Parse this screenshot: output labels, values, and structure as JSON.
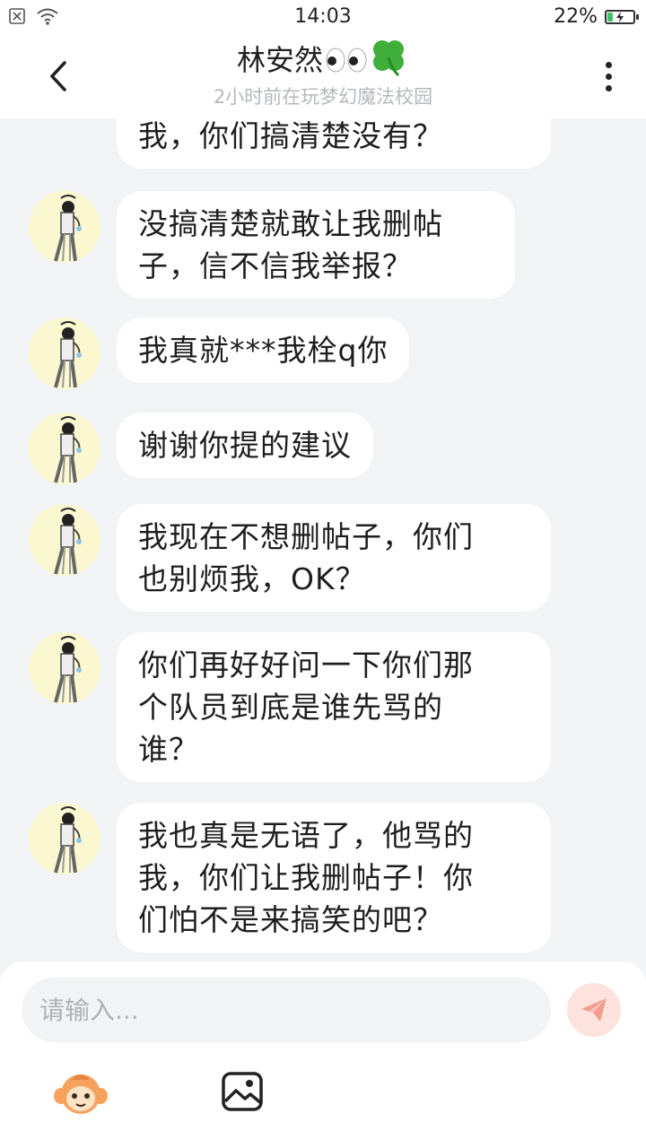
{
  "status_bar": {
    "time": "14:03",
    "battery": "22%",
    "battery_level": 0.22,
    "battery_color": "#3cc46b"
  },
  "header": {
    "title": "林安然",
    "subtitle": "2小时前在玩梦幻魔法校园"
  },
  "messages": [
    {
      "text": "我，你们搞清楚没有？"
    },
    {
      "text": "没搞清楚就敢让我删帖\n子，信不信我举报？"
    },
    {
      "text": "我真就***我栓q你"
    },
    {
      "text": "谢谢你提的建议"
    },
    {
      "text": "我现在不想删帖子，你们\n也别烦我，OK？"
    },
    {
      "text": "你们再好好问一下你们那\n个队员到底是谁先骂的\n谁？"
    },
    {
      "text": "我也真是无语了，他骂的\n我，你们让我删帖子！你\n们怕不是来搞笑的吧？"
    }
  ],
  "input": {
    "placeholder": "请输入..."
  },
  "colors": {
    "background": "#f2f3f5",
    "bubble": "#ffffff",
    "send_button": "#fde2de",
    "send_icon": "#f39b8f",
    "avatar_bg": "#fbf7d0"
  },
  "icons": [
    "close-box-icon",
    "wifi-icon",
    "battery-icon",
    "back-icon",
    "more-icon",
    "eyes-emoji-icon",
    "clover-emoji-icon",
    "send-icon",
    "emoji-sticker-icon",
    "image-icon"
  ]
}
